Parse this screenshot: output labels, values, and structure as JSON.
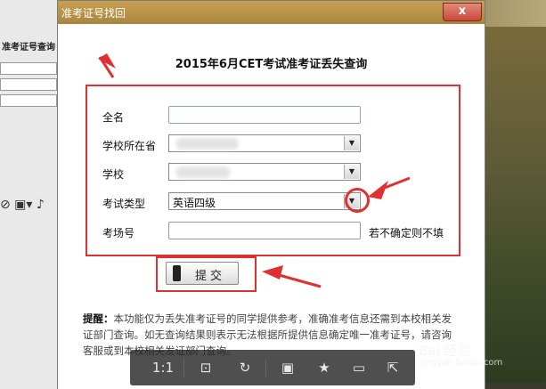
{
  "dialog": {
    "title": "准考证号找回",
    "close_label": "x"
  },
  "form": {
    "heading": "2015年6月CET考试准考证丢失查询",
    "fields": {
      "name_label": "全名",
      "province_label": "学校所在省",
      "school_label": "学校",
      "exam_type_label": "考试类型",
      "exam_type_value": "英语四级",
      "room_label": "考场号",
      "room_hint": "若不确定则不填"
    },
    "submit_label": "提交"
  },
  "tip": {
    "prefix": "提醒：",
    "text": "本功能仅为丢失准考证号的同学提供参考，准确准考信息还需到本校相关发证部门查询。如无查询结果则表示无法根据所提供信息确定唯一准考证号，请咨询客服或到本校相关发证部门查询。"
  },
  "background": {
    "left_title": "准考证号查询"
  },
  "viewer_toolbar": {
    "zoom_label": "1:1"
  },
  "watermark": {
    "main": "Bai 经验",
    "sub": "jingyan.baidu.com"
  },
  "colors": {
    "annotation_red": "#e03030",
    "titlebar": "#b8924a"
  }
}
